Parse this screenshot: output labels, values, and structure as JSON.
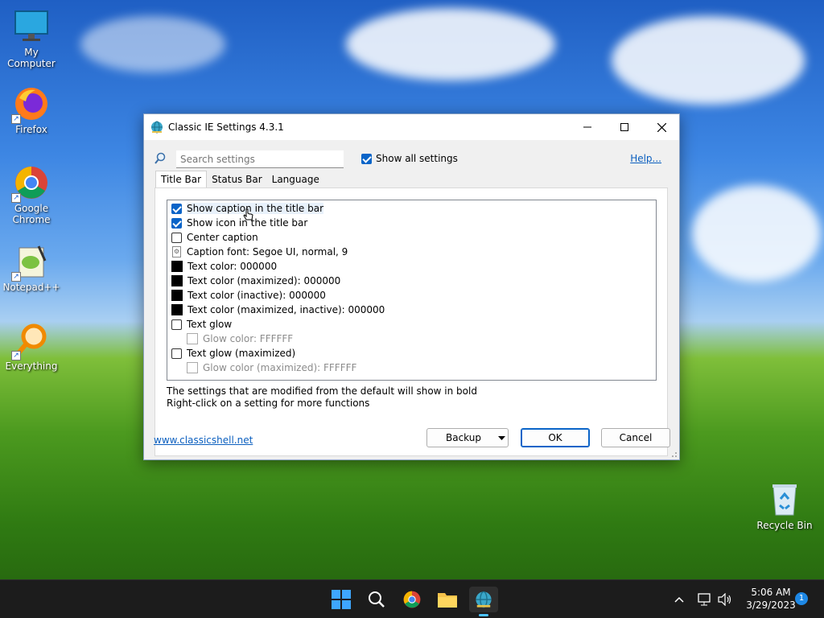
{
  "desktop": {
    "icons": [
      {
        "label": "My Computer",
        "icon": "monitor-icon"
      },
      {
        "label": "Firefox",
        "icon": "firefox-icon"
      },
      {
        "label": "Google Chrome",
        "icon": "chrome-icon"
      },
      {
        "label": "Notepad++",
        "icon": "notepad-plus-plus-icon"
      },
      {
        "label": "Everything",
        "icon": "magnifier-icon"
      },
      {
        "label": "Recycle Bin",
        "icon": "recycle-bin-icon"
      }
    ]
  },
  "window": {
    "title": "Classic IE Settings 4.3.1",
    "search": {
      "placeholder": "Search settings",
      "value": ""
    },
    "show_all_settings": {
      "label": "Show all settings",
      "checked": true
    },
    "help_link": "Help...",
    "tabs": [
      {
        "label": "Title Bar",
        "active": true
      },
      {
        "label": "Status Bar",
        "active": false
      },
      {
        "label": "Language",
        "active": false
      }
    ],
    "settings": [
      {
        "label": "Show caption in the title bar",
        "kind": "checkbox",
        "checked": true
      },
      {
        "label": "Show icon in the title bar",
        "kind": "checkbox",
        "checked": true
      },
      {
        "label": "Center caption",
        "kind": "checkbox",
        "checked": false
      },
      {
        "label": "Caption font: Segoe UI, normal, 9",
        "kind": "font"
      },
      {
        "label": "Text color: 000000",
        "kind": "color",
        "color": "#000000"
      },
      {
        "label": "Text color (maximized): 000000",
        "kind": "color",
        "color": "#000000"
      },
      {
        "label": "Text color (inactive): 000000",
        "kind": "color",
        "color": "#000000"
      },
      {
        "label": "Text color (maximized, inactive): 000000",
        "kind": "color",
        "color": "#000000"
      },
      {
        "label": "Text glow",
        "kind": "checkbox",
        "checked": false
      },
      {
        "label": "Glow color: FFFFFF",
        "kind": "color-disabled",
        "color": "#FFFFFF"
      },
      {
        "label": "Text glow (maximized)",
        "kind": "checkbox",
        "checked": false
      },
      {
        "label": "Glow color (maximized): FFFFFF",
        "kind": "color-disabled",
        "color": "#FFFFFF"
      }
    ],
    "note_line1": "The settings that are modified from the default will show in bold",
    "note_line2": "Right-click on a setting for more functions",
    "site_link": "www.classicshell.net",
    "buttons": {
      "backup": "Backup",
      "ok": "OK",
      "cancel": "Cancel"
    }
  },
  "taskbar": {
    "time": "5:06 AM",
    "date": "3/29/2023",
    "notification_count": "1"
  },
  "colors": {
    "accent": "#0a64c8",
    "link": "#0b5fbf",
    "taskbar": "#1c1c1c"
  }
}
